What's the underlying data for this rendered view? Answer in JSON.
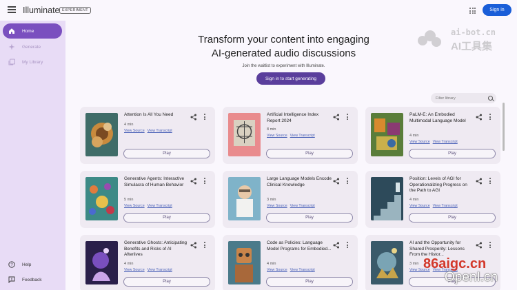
{
  "header": {
    "app_title": "Illuminate",
    "badge": "EXPERIMENT",
    "sign_in": "Sign in",
    "apps_icon": "apps-grid-icon",
    "menu_icon": "hamburger-menu-icon"
  },
  "sidebar": {
    "items": [
      {
        "label": "Home",
        "icon": "home-icon",
        "active": true
      },
      {
        "label": "Generate",
        "icon": "sparkle-icon",
        "active": false
      },
      {
        "label": "My Library",
        "icon": "library-icon",
        "active": false
      }
    ],
    "bottom": [
      {
        "label": "Help",
        "icon": "help-icon"
      },
      {
        "label": "Feedback",
        "icon": "feedback-icon"
      }
    ]
  },
  "hero": {
    "title_line1": "Transform your content into engaging",
    "title_line2": "AI-generated audio discussions",
    "subtitle": "Join the waitlist to experiment with Illuminate.",
    "cta": "Sign in to start generating"
  },
  "filter": {
    "placeholder": "Filter library"
  },
  "cards": [
    {
      "title": "Attention Is All You Need",
      "duration": "4 min"
    },
    {
      "title": "Artificial Intelligence Index Report 2024",
      "duration": "8 min"
    },
    {
      "title": "PaLM-E: An Embodied Multimodal Language Model",
      "duration": "4 min"
    },
    {
      "title": "Generative Agents: Interactive Simulacra of Human Behavior",
      "duration": "5 min"
    },
    {
      "title": "Large Language Models Encode Clinical Knowledge",
      "duration": "3 min"
    },
    {
      "title": "Position: Levels of AGI for Operationalizing Progress on the Path to AGI",
      "duration": "4 min"
    },
    {
      "title": "Generative Ghosts: Anticipating Benefits and Risks of AI Afterlives",
      "duration": "4 min"
    },
    {
      "title": "Code as Policies: Language Model Programs for Embodied...",
      "duration": "4 min"
    },
    {
      "title": "AI and the Opportunity for Shared Prosperity: Lessons From the Histor...",
      "duration": "3 min"
    }
  ],
  "card_actions": {
    "view_source": "View Source",
    "view_transcript": "View Transcript",
    "play": "Play"
  },
  "watermarks": {
    "top_line1": "ai-bot.cn",
    "top_line2": "AI工具集",
    "bottom_line1": "86aigc.cn",
    "bottom_line2": "OpenI.cn"
  },
  "colors": {
    "accent": "#1a5ed8",
    "sidebar_bg": "#e8dcf6",
    "active_nav": "#7a4fbf",
    "cta": "#5a3e9c",
    "card_bg": "#efeaf2"
  }
}
